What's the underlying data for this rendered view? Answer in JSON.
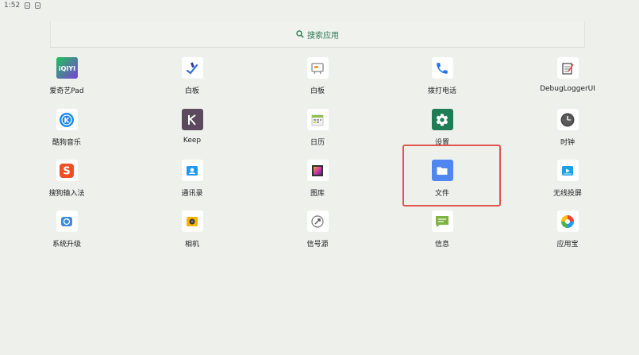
{
  "status_bar": {
    "time": "1:52"
  },
  "search": {
    "label": "搜索应用"
  },
  "apps": [
    {
      "label": "爱奇艺Pad"
    },
    {
      "label": "白板"
    },
    {
      "label": "白板"
    },
    {
      "label": "拨打电话"
    },
    {
      "label": "DebugLoggerUI"
    },
    {
      "label": "酷狗音乐"
    },
    {
      "label": "Keep"
    },
    {
      "label": "日历"
    },
    {
      "label": "设置"
    },
    {
      "label": "时钟"
    },
    {
      "label": "搜狗输入法"
    },
    {
      "label": "通讯录"
    },
    {
      "label": "图库"
    },
    {
      "label": "文件"
    },
    {
      "label": "无线投屏"
    },
    {
      "label": "系统升级"
    },
    {
      "label": "相机"
    },
    {
      "label": "信号源"
    },
    {
      "label": "信息"
    },
    {
      "label": "应用宝"
    }
  ],
  "colors": {
    "highlight": "#e0534f",
    "accent": "#2e7d57",
    "background": "#eef0ec"
  }
}
